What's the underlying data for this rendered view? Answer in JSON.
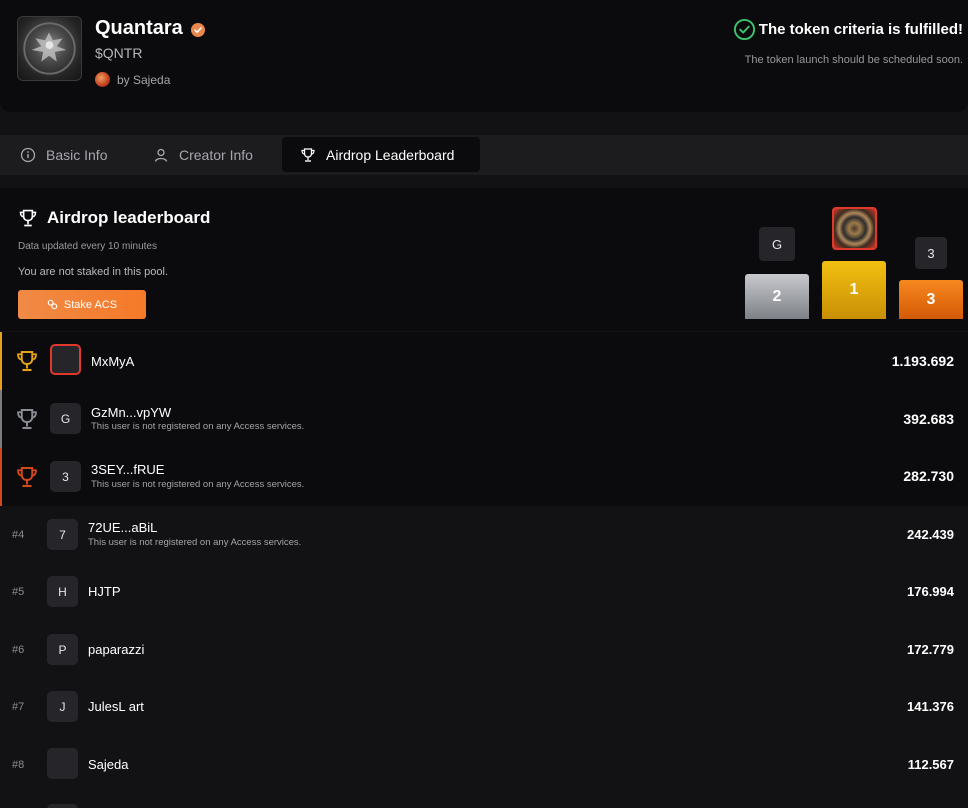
{
  "header": {
    "token_name": "Quantara",
    "ticker": "$QNTR",
    "creator": "by Sajeda",
    "criteria_title": "The token criteria is fulfilled!",
    "criteria_sub": "The token launch should be scheduled soon.",
    "accent_color": "#e9884c",
    "success_color": "#3ec46d"
  },
  "tabs": [
    {
      "label": "Basic Info",
      "icon": "info-icon"
    },
    {
      "label": "Creator Info",
      "icon": "user-icon"
    },
    {
      "label": "Airdrop Leaderboard",
      "icon": "trophy-icon",
      "active": true
    }
  ],
  "leaderboard": {
    "title": "Airdrop leaderboard",
    "updated": "Data updated every 10 minutes",
    "not_staked": "You are not staked in this pool.",
    "stake_button": "Stake ACS",
    "podium": {
      "first_label": "1",
      "second_label": "2",
      "third_label": "3",
      "second_avatar": "G",
      "third_avatar": "3"
    },
    "rows": [
      {
        "rank": "1",
        "avatar": "",
        "name": "MxMyA",
        "note": "",
        "value": "1.193.692",
        "medal": "gold"
      },
      {
        "rank": "2",
        "avatar": "G",
        "name": "GzMn...vpYW",
        "note": "This user is not registered on any Access services.",
        "value": "392.683",
        "medal": "silver"
      },
      {
        "rank": "3",
        "avatar": "3",
        "name": "3SEY...fRUE",
        "note": "This user is not registered on any Access services.",
        "value": "282.730",
        "medal": "bronze"
      },
      {
        "rank": "#4",
        "avatar": "7",
        "name": "72UE...aBiL",
        "note": "This user is not registered on any Access services.",
        "value": "242.439"
      },
      {
        "rank": "#5",
        "avatar": "H",
        "name": "HJTP",
        "note": "",
        "value": "176.994"
      },
      {
        "rank": "#6",
        "avatar": "P",
        "name": "paparazzi",
        "note": "",
        "value": "172.779"
      },
      {
        "rank": "#7",
        "avatar": "J",
        "name": "JulesL art",
        "note": "",
        "value": "141.376"
      },
      {
        "rank": "#8",
        "avatar": "",
        "name": "Sajeda",
        "note": "",
        "value": "112.567"
      }
    ]
  }
}
